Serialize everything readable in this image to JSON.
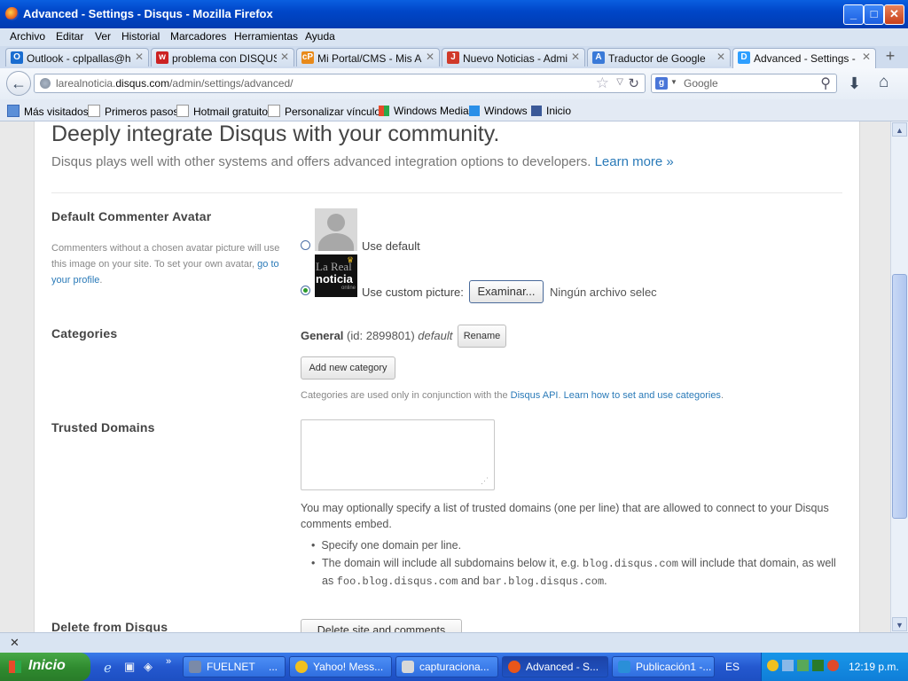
{
  "window": {
    "title": "Advanced - Settings - Disqus - Mozilla Firefox"
  },
  "menu": [
    "Archivo",
    "Editar",
    "Ver",
    "Historial",
    "Marcadores",
    "Herramientas",
    "Ayuda"
  ],
  "tabs": [
    {
      "label": "Outlook - cplpallas@ho...",
      "color": "#1a6dd0",
      "icon": "O"
    },
    {
      "label": "problema con DISQUS (...",
      "color": "#cc2222",
      "icon": "w"
    },
    {
      "label": "Mi Portal/CMS - Mis Apli...",
      "color": "#e88a1a",
      "icon": "cP"
    },
    {
      "label": "Nuevo Noticias - Admini...",
      "color": "#d03a2a",
      "icon": "J"
    },
    {
      "label": "Traductor de Google",
      "color": "#3a7ad8",
      "icon": "A"
    },
    {
      "label": "Advanced - Settings - ...",
      "color": "#2e9fff",
      "icon": "D"
    }
  ],
  "navbar": {
    "url_prefix": "larealnoticia.",
    "url_domain": "disqus.com",
    "url_path": "/admin/settings/advanced/",
    "search_placeholder": "Google"
  },
  "bookmarks": [
    "Más visitados",
    "Primeros pasos",
    "Hotmail gratuito",
    "Personalizar vínculos",
    "Windows Media",
    "Windows",
    "Inicio"
  ],
  "page": {
    "heading": "Deeply integrate Disqus with your community.",
    "subtext": "Disqus plays well with other systems and offers advanced integration options to developers.",
    "learn_more": "Learn more »",
    "avatar": {
      "title": "Default Commenter Avatar",
      "desc": "Commenters without a chosen avatar picture will use this image on your site. To set your own avatar,",
      "desc_link": "go to your profile",
      "use_default": "Use default",
      "use_custom": "Use custom picture:",
      "browse": "Examinar...",
      "no_file": "Ningún archivo selec",
      "logo_top": "La Real",
      "logo_main": "noticia",
      "logo_sub": "online"
    },
    "categories": {
      "title": "Categories",
      "name": "General",
      "id_text": "(id: 2899801)",
      "default_text": "default",
      "rename": "Rename",
      "add_new": "Add new category",
      "note_pre": "Categories are used only in conjunction with the",
      "note_link1": "Disqus API",
      "note_link2": "Learn how to set and use categories"
    },
    "trusted": {
      "title": "Trusted Domains",
      "textarea_value": "",
      "desc": "You may optionally specify a list of trusted domains (one per line) that are allowed to connect to your Disqus comments embed.",
      "bullet1": "Specify one domain per line.",
      "bullet2_pre": "The domain will include all subdomains below it, e.g.",
      "code1": "blog.disqus.com",
      "bullet2_mid": "will include that domain, as well as",
      "code2": "foo.blog.disqus.com",
      "and": "and",
      "code3": "bar.blog.disqus.com"
    },
    "delete": {
      "title": "Delete from Disqus",
      "button": "Delete site and comments"
    }
  },
  "taskbar": {
    "start": "Inicio",
    "tasks": [
      {
        "label": "FUELNET",
        "color": "#7a8aa8"
      },
      {
        "label": "Yahoo! Mess...",
        "color": "#f0c020"
      },
      {
        "label": "capturaciona...",
        "color": "#d8d8d8"
      },
      {
        "label": "Advanced - S...",
        "color": "#e8561a"
      },
      {
        "label": "Publicación1 -...",
        "color": "#2a8fd8"
      }
    ],
    "lang": "ES",
    "time": "12:19 p.m."
  }
}
